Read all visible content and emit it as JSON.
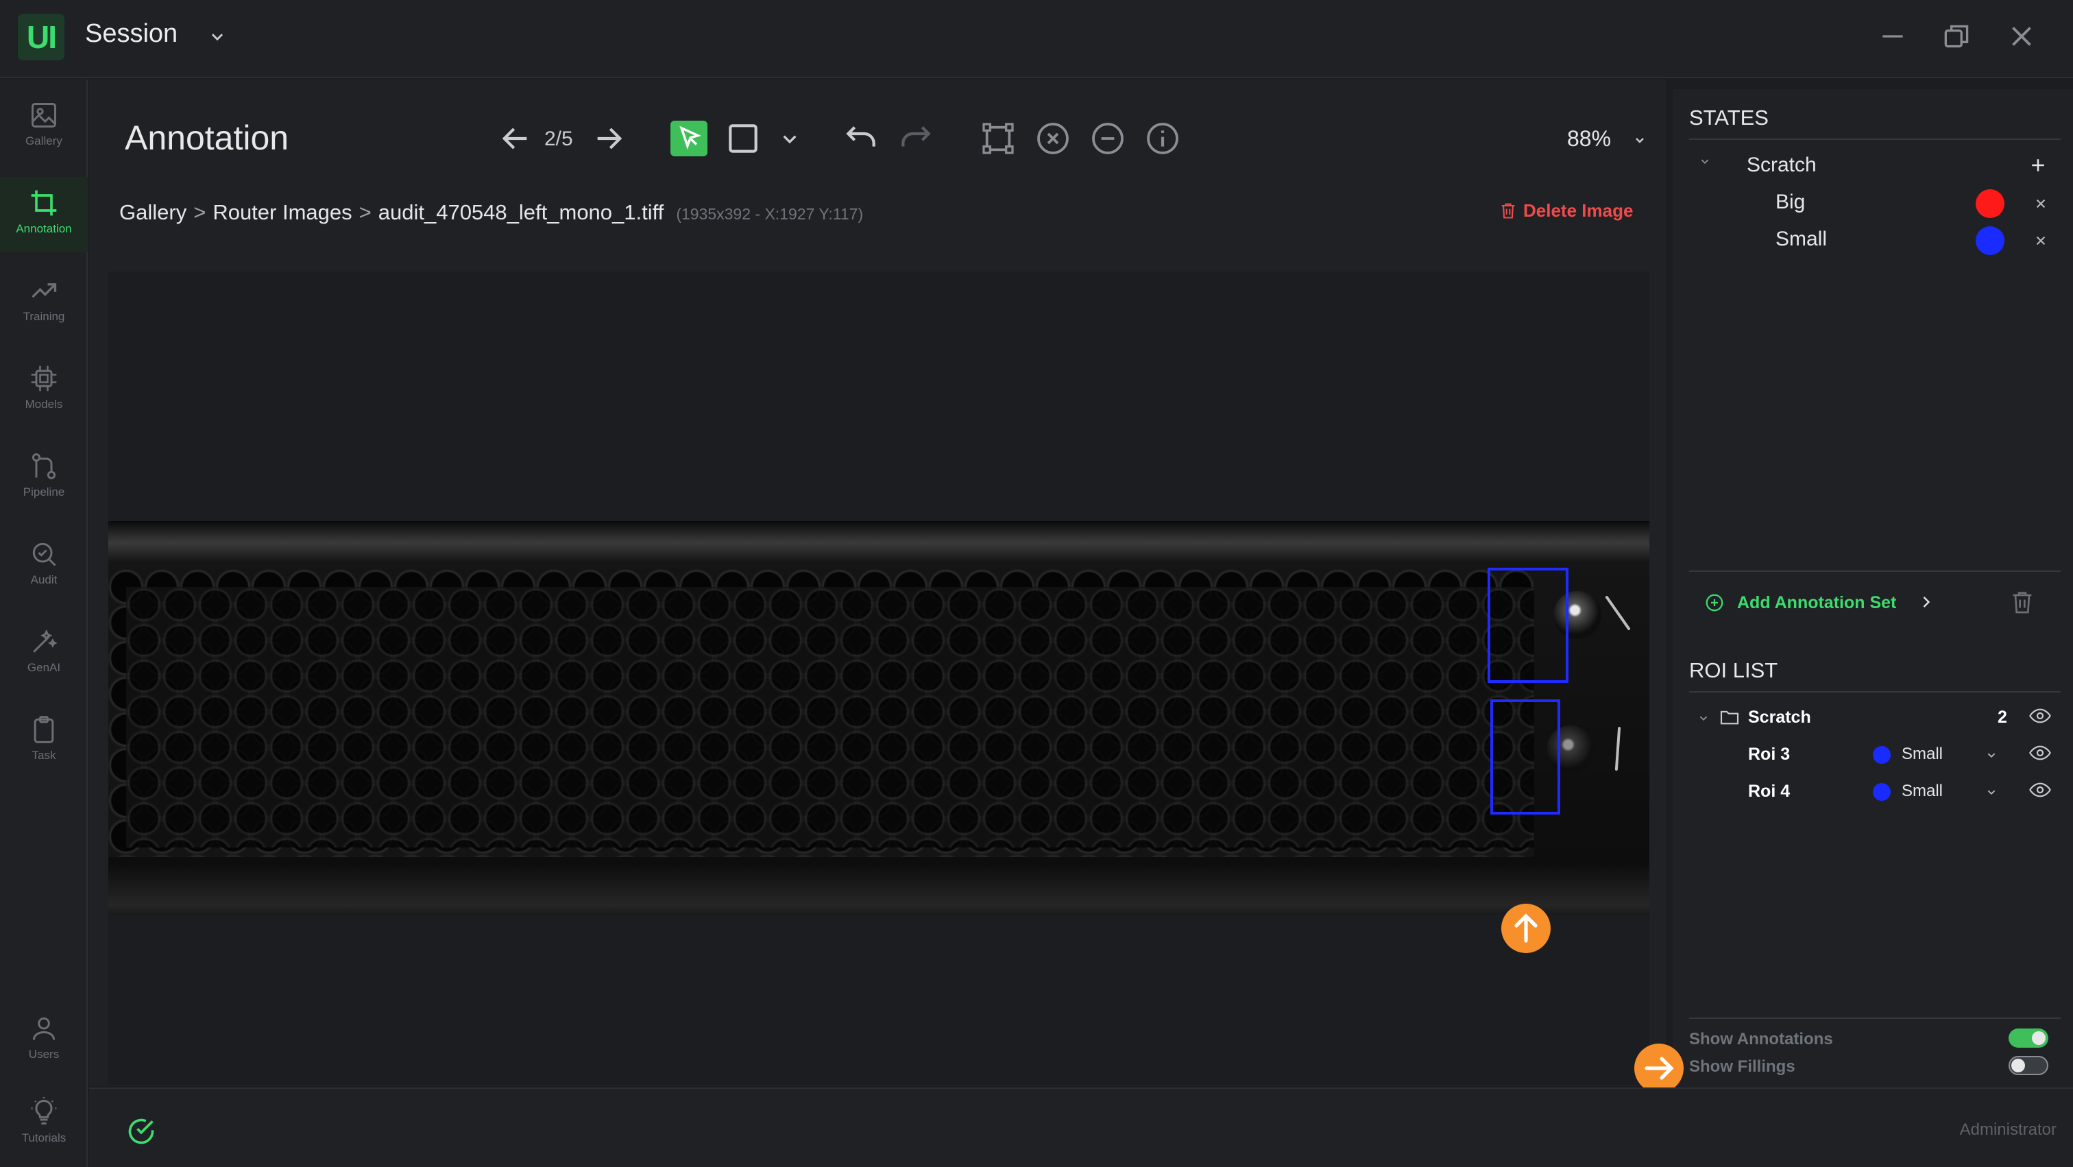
{
  "app": {
    "logo": "UI",
    "title": "Session"
  },
  "nav": [
    {
      "label": "Gallery",
      "icon": "gallery-icon"
    },
    {
      "label": "Annotation",
      "icon": "crop-icon"
    },
    {
      "label": "Training",
      "icon": "trend-icon"
    },
    {
      "label": "Models",
      "icon": "chip-icon"
    },
    {
      "label": "Pipeline",
      "icon": "pipeline-icon"
    },
    {
      "label": "Audit",
      "icon": "audit-icon"
    },
    {
      "label": "GenAI",
      "icon": "wand-icon"
    },
    {
      "label": "Task",
      "icon": "clipboard-icon"
    },
    {
      "label": "Users",
      "icon": "user-icon"
    },
    {
      "label": "Tutorials",
      "icon": "bulb-icon"
    }
  ],
  "toolbar": {
    "page_title": "Annotation",
    "page_counter": "2/5",
    "zoom": "88%"
  },
  "breadcrumb": {
    "gallery": "Gallery",
    "folder": "Router Images",
    "file": "audit_470548_left_mono_1.tiff",
    "meta": "(1935x392 - X:1927 Y:117)",
    "separator": ">"
  },
  "delete_image": "Delete Image",
  "states": {
    "title": "STATES",
    "set": "Scratch",
    "items": [
      {
        "label": "Big",
        "color": "#ff1a1a"
      },
      {
        "label": "Small",
        "color": "#1a2bff"
      }
    ]
  },
  "add_annotation_set": "Add Annotation Set",
  "roi_list": {
    "title": "ROI LIST",
    "group": "Scratch",
    "count": "2",
    "items": [
      {
        "label": "Roi 3",
        "state": "Small",
        "color": "#1a2bff"
      },
      {
        "label": "Roi 4",
        "state": "Small",
        "color": "#1a2bff"
      }
    ]
  },
  "toggles": {
    "show_annotations": "Show Annotations",
    "show_annotations_on": true,
    "show_fillings": "Show Fillings",
    "show_fillings_on": false
  },
  "status": {
    "user_role": "Administrator"
  },
  "colors": {
    "accent": "#3ddc6e",
    "danger": "#f24a4a",
    "cursor": "#f7902a",
    "roi": "#1f2bff"
  }
}
